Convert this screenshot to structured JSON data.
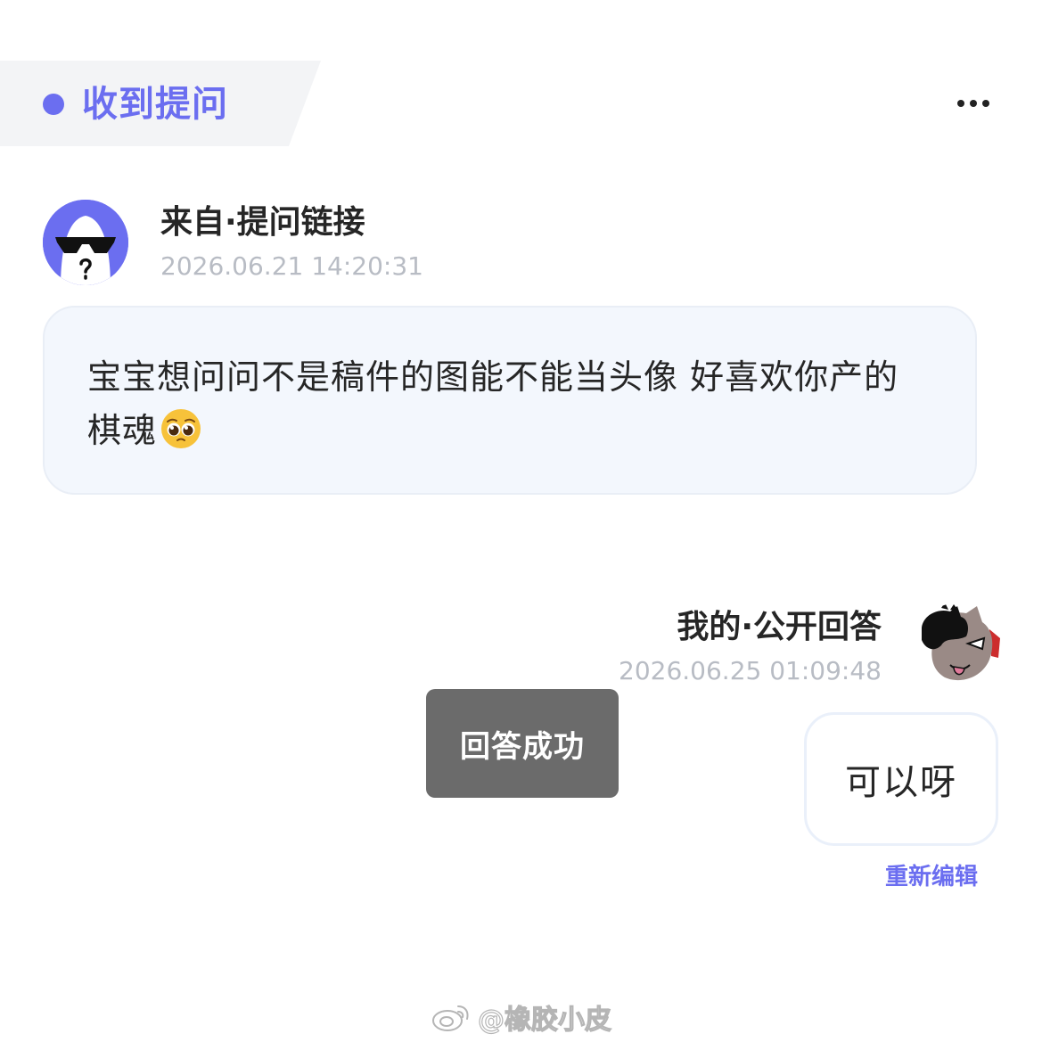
{
  "header": {
    "title": "收到提问"
  },
  "question": {
    "source": "来自·提问链接",
    "time": "2026.06.21 14:20:31",
    "text": "宝宝想问问不是稿件的图能不能当头像 好喜欢你产的棋魂",
    "emoji": "pleading-face-emoji"
  },
  "answer": {
    "source": "我的·公开回答",
    "time": "2026.06.25 01:09:48",
    "text": "可以呀",
    "edit_label": "重新编辑"
  },
  "toast": {
    "text": "回答成功"
  },
  "watermark": {
    "text": "@橡胶小皮"
  },
  "colors": {
    "accent": "#6b6ef0",
    "bubble_bg": "#f3f7fd",
    "toast_bg": "#6b6b6b"
  }
}
